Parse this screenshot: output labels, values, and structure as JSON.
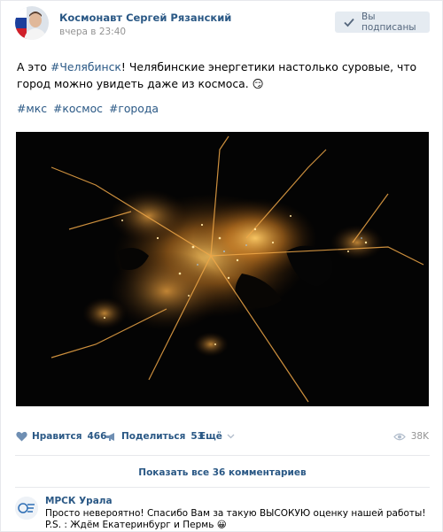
{
  "post": {
    "author": "Космонавт Сергей Рязанский",
    "time": "вчера в 23:40",
    "subscribed_label": "Вы подписаны",
    "text_before": "А это ",
    "text_link": "#Челябинск",
    "text_after": "! Челябинские энергетики настолько суровые, что город можно увидеть даже из космоса. 😏",
    "tags": [
      "#мкс",
      "#космос",
      "#города"
    ],
    "photo_icon": "night-city-photo"
  },
  "actions": {
    "like_label": "Нравится",
    "like_count": "466",
    "share_label": "Поделиться",
    "share_count": "53",
    "more_label": "Ещё",
    "views": "38K"
  },
  "comments": {
    "show_all_label": "Показать все 36 комментариев",
    "items": [
      {
        "author": "МРСК Урала",
        "line1": "Просто невероятно! Спасибо Вам за такую ВЫСОКУЮ оценку нашей работы!",
        "line2": "P.S. : Ждём Екатеринбург и Пермь 😀"
      }
    ]
  },
  "colors": {
    "link": "#2a5885",
    "muted": "#939393",
    "button_bg": "#e5ebf1"
  }
}
